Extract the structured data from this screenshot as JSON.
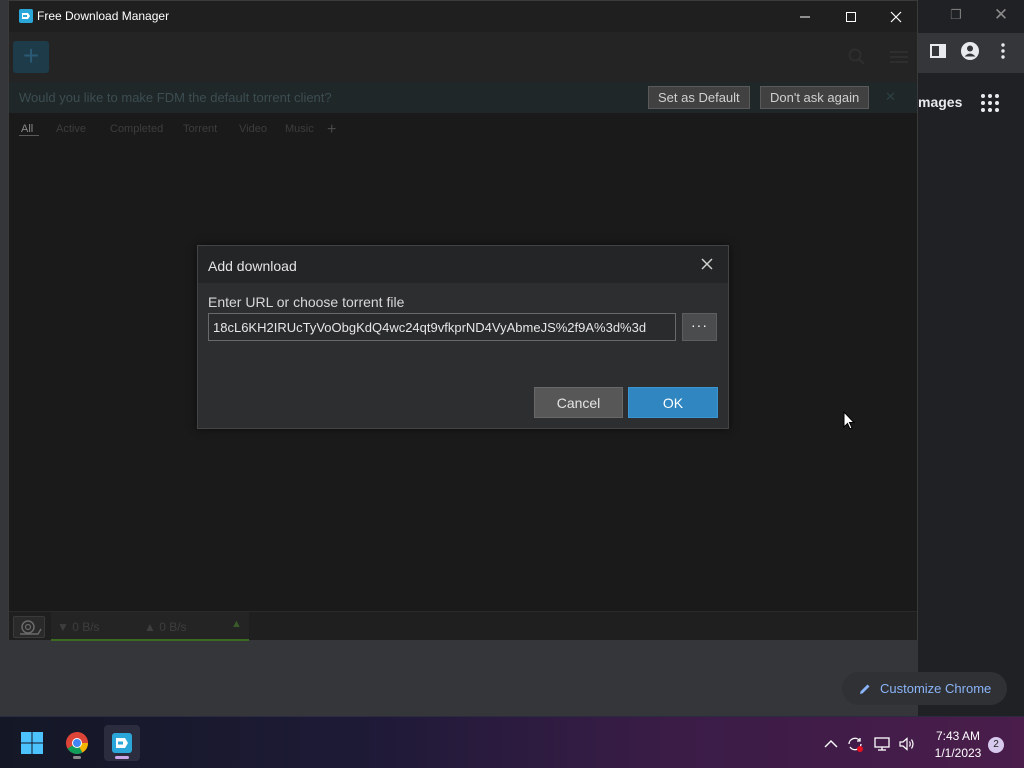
{
  "fdm": {
    "window_title": "Free Download Manager",
    "add_symbol": "+",
    "infobar": {
      "text": "Would you like to make FDM the default torrent client?",
      "set_default_label": "Set as Default",
      "dont_ask_label": "Don't ask again",
      "close_symbol": "✕"
    },
    "tabs": [
      {
        "label": "All"
      },
      {
        "label": "Active"
      },
      {
        "label": "Completed"
      },
      {
        "label": "Torrent"
      },
      {
        "label": "Video"
      },
      {
        "label": "Music"
      }
    ],
    "add_tab_symbol": "+",
    "status": {
      "download_speed": "▼ 0 B/s",
      "upload_speed": "▲ 0 B/s",
      "expand_symbol": "▲"
    }
  },
  "dialog": {
    "title": "Add download",
    "url_label": "Enter URL or choose torrent file",
    "url_value": "18cL6KH2IRUcTyVoObgKdQ4wc24qt9vfkprND4VyAbmeJS%2f9A%3d%3d",
    "browse_label": "···",
    "cancel_label": "Cancel",
    "ok_label": "OK"
  },
  "chrome": {
    "images_link": "mages",
    "customize_label": "Customize Chrome",
    "restore_symbol": "❐",
    "close_symbol": "✕"
  },
  "taskbar": {
    "time": "7:43 AM",
    "date": "1/1/2023",
    "notification_count": "2"
  },
  "colors": {
    "ok_accent": "#2f86c0",
    "link_blue": "#8ab4f8",
    "speed_bar_green": "#3c6a1e"
  }
}
